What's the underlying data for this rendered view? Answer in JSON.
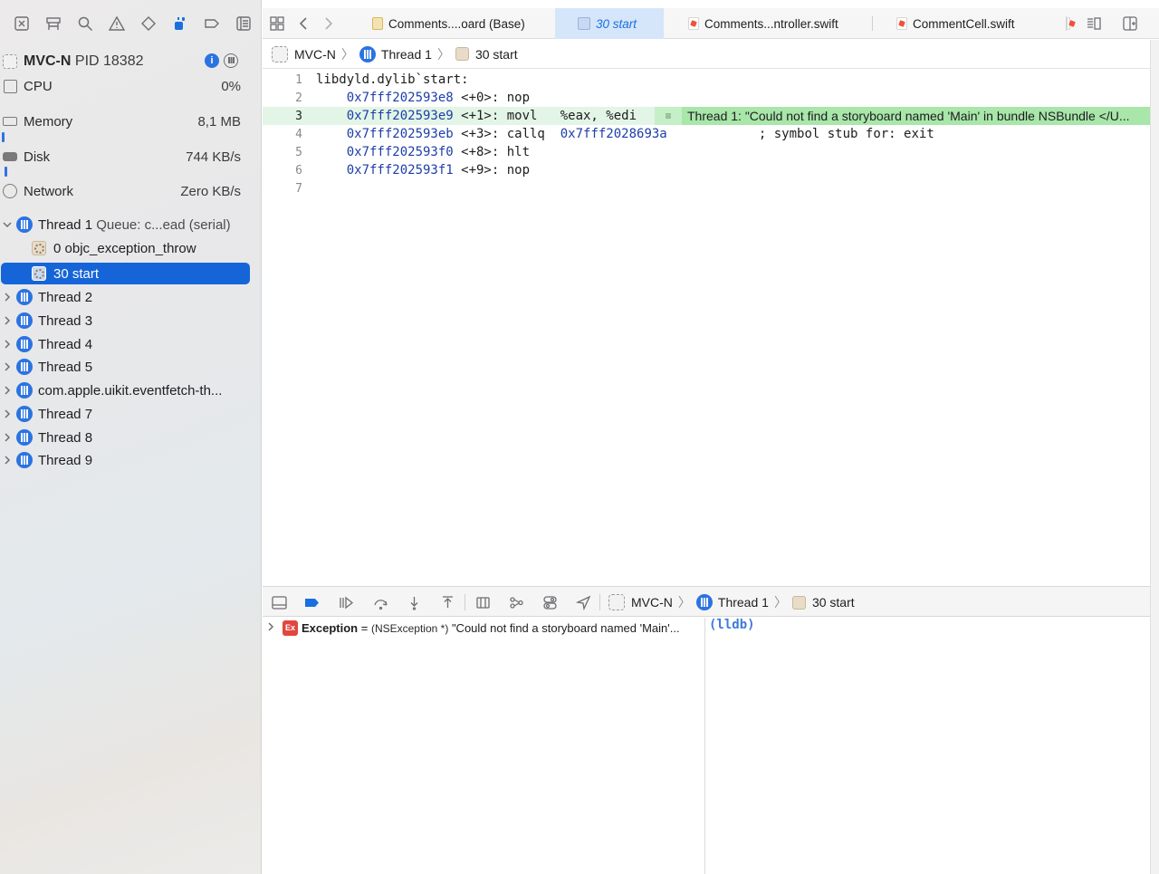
{
  "navigator": {
    "icons": [
      "project-navigator-icon",
      "source-control-icon",
      "find-icon",
      "issue-icon",
      "test-icon",
      "debug-navigator-icon",
      "breakpoint-icon",
      "report-icon"
    ],
    "process": {
      "name": "MVC-N",
      "pid_label": "PID 18382"
    },
    "gauges": [
      {
        "label": "CPU",
        "value": "0%",
        "level": 0
      },
      {
        "label": "Memory",
        "value": "8,1 MB",
        "level": 0.01
      },
      {
        "label": "Disk",
        "value": "744 KB/s",
        "level": 0.01
      },
      {
        "label": "Network",
        "value": "Zero KB/s",
        "level": 0
      }
    ],
    "thread1": {
      "name": "Thread 1",
      "queue": "Queue: c...ead (serial)"
    },
    "frames": [
      "0 objc_exception_throw",
      "30 start"
    ],
    "threads": [
      "Thread 2",
      "Thread 3",
      "Thread 4",
      "Thread 5",
      "com.apple.uikit.eventfetch-th...",
      "Thread 7",
      "Thread 8",
      "Thread 9"
    ]
  },
  "tabs": [
    {
      "label": "Comments....oard (Base)",
      "kind": "storyboard"
    },
    {
      "label": "30 start",
      "kind": "frame"
    },
    {
      "label": "Comments...ntroller.swift",
      "kind": "swift"
    },
    {
      "label": "CommentCell.swift",
      "kind": "swift"
    }
  ],
  "jumpbar": {
    "project": "MVC-N",
    "thread": "Thread 1",
    "frame": "30 start"
  },
  "code": {
    "lines": [
      {
        "num": "1",
        "addr": "",
        "text": "libdyld.dylib`start:"
      },
      {
        "num": "2",
        "addr": "    0x7fff202593e8",
        "text": " <+0>: nop"
      },
      {
        "num": "3",
        "addr": "    0x7fff202593e9",
        "text": " <+1>: movl   %eax, %edi"
      },
      {
        "num": "4",
        "addr": "    0x7fff202593eb",
        "text": " <+3>: callq  ",
        "target": "0x7fff2028693a",
        "comment": "            ; symbol stub for: exit"
      },
      {
        "num": "5",
        "addr": "    0x7fff202593f0",
        "text": " <+8>: hlt"
      },
      {
        "num": "6",
        "addr": "    0x7fff202593f1",
        "text": " <+9>: nop"
      },
      {
        "num": "7",
        "addr": "",
        "text": ""
      }
    ],
    "annotation": "Thread 1: \"Could not find a storyboard named 'Main' in bundle NSBundle </U..."
  },
  "debugbar": {
    "project": "MVC-N",
    "thread": "Thread 1",
    "frame": "30 start"
  },
  "variables": {
    "badge": "Ex",
    "name": "Exception",
    "eq": " = ",
    "type": "(NSException *)",
    "value": " \"Could not find a storyboard named 'Main'..."
  },
  "console": {
    "prompt": "(lldb)"
  },
  "colors": {
    "accent": "#1665d8",
    "current_line": "#e2f5e6",
    "annotation": "#a8e6a9",
    "address": "#1d3ea8"
  }
}
